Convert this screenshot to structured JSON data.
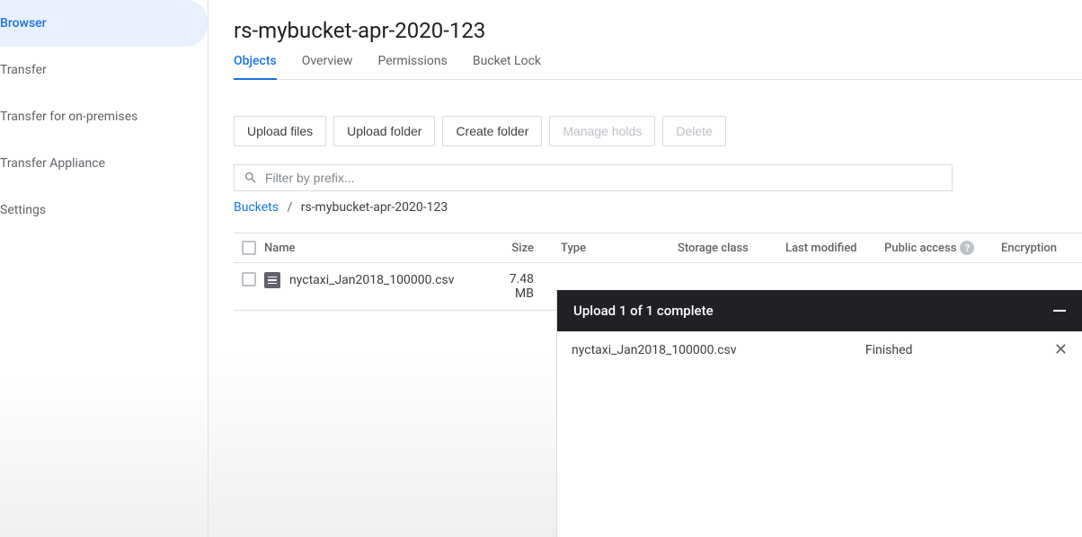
{
  "sidebar": {
    "items": [
      {
        "label": "Browser",
        "active": true
      },
      {
        "label": "Transfer"
      },
      {
        "label": "Transfer for on-premises"
      },
      {
        "label": "Transfer Appliance"
      },
      {
        "label": "Settings"
      }
    ]
  },
  "page": {
    "title": "rs-mybucket-apr-2020-123"
  },
  "tabs": [
    {
      "label": "Objects",
      "active": true
    },
    {
      "label": "Overview"
    },
    {
      "label": "Permissions"
    },
    {
      "label": "Bucket Lock"
    }
  ],
  "toolbar": {
    "upload_files": "Upload files",
    "upload_folder": "Upload folder",
    "create_folder": "Create folder",
    "manage_holds": "Manage holds",
    "delete": "Delete"
  },
  "filter": {
    "placeholder": "Filter by prefix..."
  },
  "breadcrumb": {
    "root": "Buckets",
    "sep": "/",
    "current": "rs-mybucket-apr-2020-123"
  },
  "table": {
    "headers": {
      "name": "Name",
      "size": "Size",
      "type": "Type",
      "storage": "Storage class",
      "modified": "Last modified",
      "public": "Public access",
      "encryption": "Encryption"
    },
    "rows": [
      {
        "name": "nyctaxi_Jan2018_100000.csv",
        "size": "7.48 MB"
      }
    ]
  },
  "upload_panel": {
    "title": "Upload 1 of 1 complete",
    "items": [
      {
        "name": "nyctaxi_Jan2018_100000.csv",
        "status": "Finished"
      }
    ]
  }
}
